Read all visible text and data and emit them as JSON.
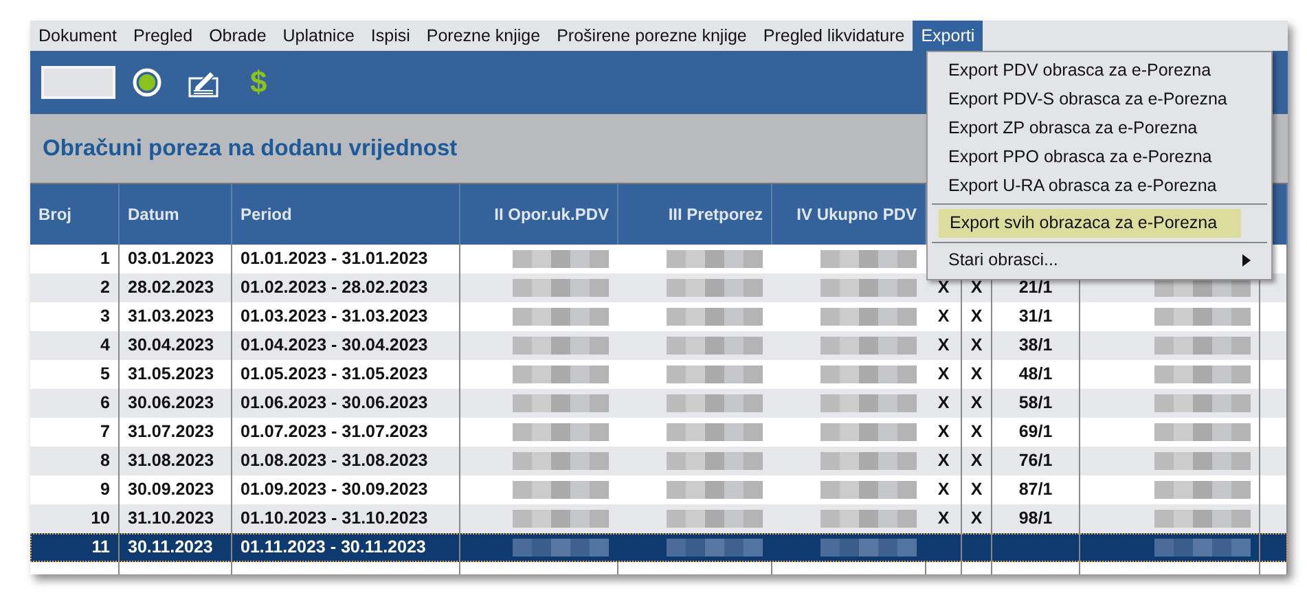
{
  "menu_bar": [
    {
      "label": "Dokument",
      "selected": false
    },
    {
      "label": "Pregled",
      "selected": false
    },
    {
      "label": "Obrade",
      "selected": false
    },
    {
      "label": "Uplatnice",
      "selected": false
    },
    {
      "label": "Ispisi",
      "selected": false
    },
    {
      "label": "Porezne knjige",
      "selected": false
    },
    {
      "label": "Proširene porezne knjige",
      "selected": false
    },
    {
      "label": "Pregled likvidature",
      "selected": false
    },
    {
      "label": "Exporti",
      "selected": true
    }
  ],
  "toolbar": {
    "dollar_button": "$"
  },
  "page_title": "Obračuni poreza na dodanu vrijednost",
  "table": {
    "columns": [
      "Broj",
      "Datum",
      "Period",
      "II Opor.uk.PDV",
      "III Pretporez",
      "IV Ukupno PDV"
    ],
    "rows": [
      {
        "broj": "1",
        "datum": "03.01.2023",
        "period": "01.01.2023 - 31.01.2023",
        "selected": false
      },
      {
        "broj": "2",
        "datum": "28.02.2023",
        "period": "01.02.2023 - 28.02.2023",
        "column_7": "X",
        "column_8": "X",
        "column_9": "21/1",
        "selected": false
      },
      {
        "broj": "3",
        "datum": "31.03.2023",
        "period": "01.03.2023 - 31.03.2023",
        "column_7": "X",
        "column_8": "X",
        "column_9": "31/1",
        "selected": false
      },
      {
        "broj": "4",
        "datum": "30.04.2023",
        "period": "01.04.2023 - 30.04.2023",
        "column_7": "X",
        "column_8": "X",
        "column_9": "38/1",
        "selected": false
      },
      {
        "broj": "5",
        "datum": "31.05.2023",
        "period": "01.05.2023 - 31.05.2023",
        "column_7": "X",
        "column_8": "X",
        "column_9": "48/1",
        "selected": false
      },
      {
        "broj": "6",
        "datum": "30.06.2023",
        "period": "01.06.2023 - 30.06.2023",
        "column_7": "X",
        "column_8": "X",
        "column_9": "58/1",
        "selected": false
      },
      {
        "broj": "7",
        "datum": "31.07.2023",
        "period": "01.07.2023 - 31.07.2023",
        "column_7": "X",
        "column_8": "X",
        "column_9": "69/1",
        "selected": false
      },
      {
        "broj": "8",
        "datum": "31.08.2023",
        "period": "01.08.2023 - 31.08.2023",
        "column_7": "X",
        "column_8": "X",
        "column_9": "76/1",
        "selected": false
      },
      {
        "broj": "9",
        "datum": "30.09.2023",
        "period": "01.09.2023 - 30.09.2023",
        "column_7": "X",
        "column_8": "X",
        "column_9": "87/1",
        "selected": false
      },
      {
        "broj": "10",
        "datum": "31.10.2023",
        "period": "01.10.2023 - 31.10.2023",
        "column_7": "X",
        "column_8": "X",
        "column_9": "98/1",
        "selected": false
      },
      {
        "broj": "11",
        "datum": "30.11.2023",
        "period": "01.11.2023 - 30.11.2023",
        "selected": true
      }
    ]
  },
  "exporti_menu": [
    {
      "kind": "item",
      "label": "Export PDV obrasca za e-Porezna",
      "selected": false
    },
    {
      "kind": "item",
      "label": "Export PDV-S obrasca za e-Porezna",
      "selected": false
    },
    {
      "kind": "item",
      "label": "Export ZP obrasca za e-Porezna",
      "selected": false
    },
    {
      "kind": "item",
      "label": "Export PPO obrasca za e-Porezna",
      "selected": false
    },
    {
      "kind": "item",
      "label": "Export U-RA obrasca za e-Porezna",
      "selected": false
    },
    {
      "kind": "separator"
    },
    {
      "kind": "item",
      "label": "Export svih obrazaca za e-Porezna",
      "selected": true
    },
    {
      "kind": "separator"
    },
    {
      "kind": "submenu",
      "label": "Stari obrasci...",
      "selected": false
    }
  ]
}
